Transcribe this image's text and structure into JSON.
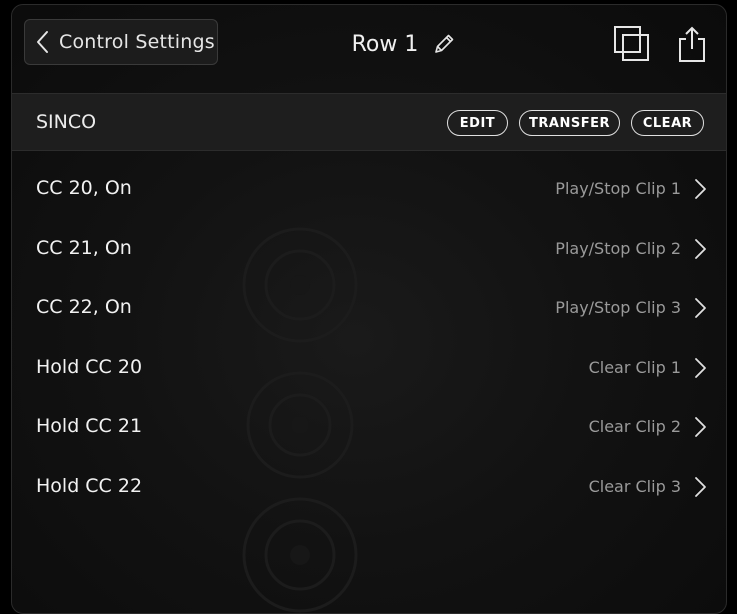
{
  "header": {
    "back_label": "Control Settings",
    "title": "Row 1"
  },
  "section": {
    "title": "SINCO",
    "buttons": {
      "edit": "EDIT",
      "transfer": "TRANSFER",
      "clear": "CLEAR"
    }
  },
  "mappings": [
    {
      "control": "CC 20, On",
      "action": "Play/Stop Clip 1"
    },
    {
      "control": "CC 21, On",
      "action": "Play/Stop Clip 2"
    },
    {
      "control": "CC 22, On",
      "action": "Play/Stop Clip 3"
    },
    {
      "control": "Hold CC 20",
      "action": "Clear Clip 1"
    },
    {
      "control": "Hold CC 21",
      "action": "Clear Clip 2"
    },
    {
      "control": "Hold CC 22",
      "action": "Clear Clip 3"
    }
  ],
  "icons": {
    "back": "chevron-left-icon",
    "edit_title": "pencil-icon",
    "duplicate": "duplicate-icon",
    "share": "share-icon",
    "row_disclosure": "chevron-right-icon"
  },
  "colors": {
    "background": "#000000",
    "panel": "#121212",
    "section_bar": "#1e1e1e",
    "primary_text": "#f2f2f2",
    "secondary_text": "#9a9a9a"
  }
}
